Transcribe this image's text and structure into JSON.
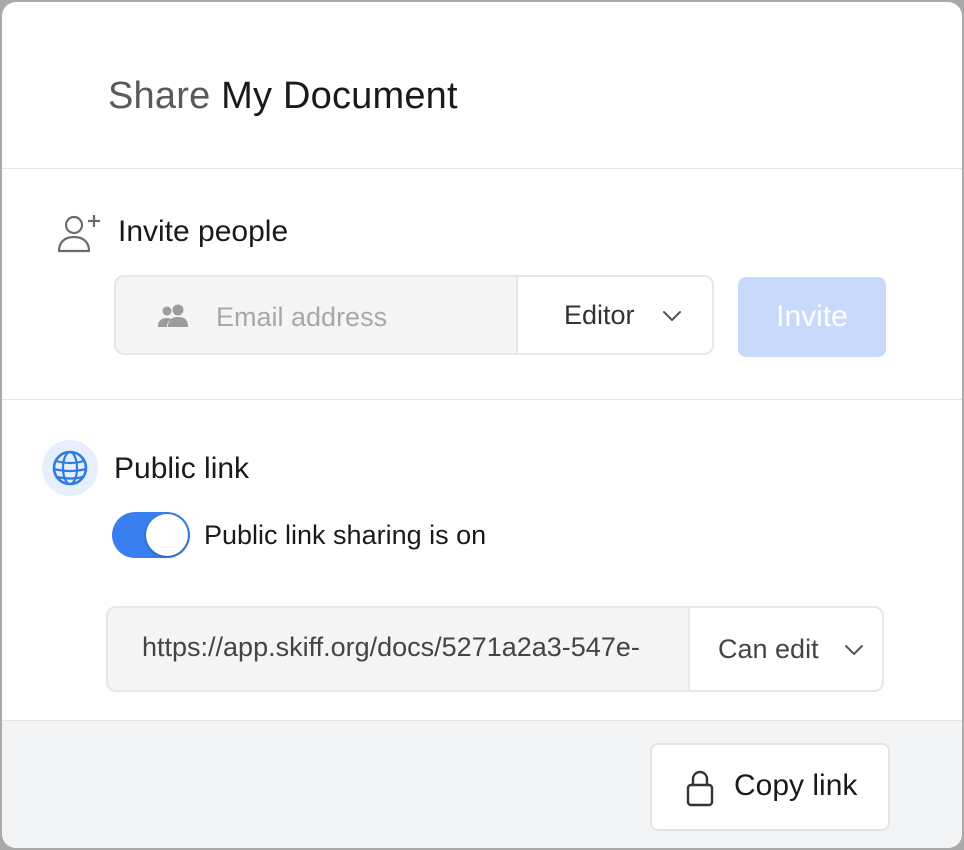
{
  "dialog": {
    "title_prefix": "Share",
    "document_name": "My Document"
  },
  "invite": {
    "section_title": "Invite people",
    "email_placeholder": "Email address",
    "email_value": "",
    "role_selected": "Editor",
    "invite_button_label": "Invite",
    "icons": {
      "section": "add-person-icon",
      "field": "people-icon",
      "dropdown": "chevron-down-icon"
    }
  },
  "public_link": {
    "section_title": "Public link",
    "toggle_label": "Public link sharing is on",
    "toggle_on": true,
    "url": "https://app.skiff.org/docs/5271a2a3-547e-",
    "permission_selected": "Can edit",
    "icons": {
      "section": "globe-icon",
      "dropdown": "chevron-down-icon"
    }
  },
  "footer": {
    "copy_button_label": "Copy link",
    "icon": "lock-icon"
  },
  "colors": {
    "accent": "#3a7ff0",
    "invite_disabled": "#c7dafc",
    "globe_bg": "#e6f0fd",
    "footer_bg": "#f3f4f6"
  }
}
